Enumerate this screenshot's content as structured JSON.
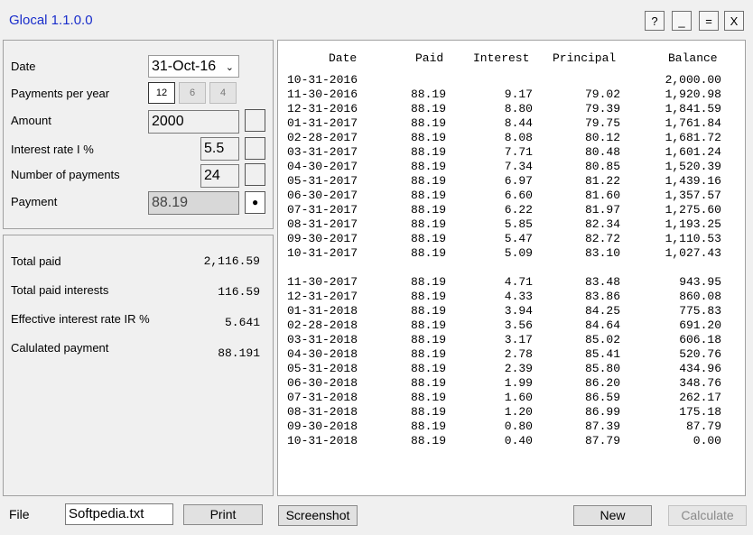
{
  "app": {
    "title": "Glocal 1.1.0.0"
  },
  "window_buttons": {
    "help": "?",
    "minimize": "_",
    "maximize": "=",
    "close": "X"
  },
  "inputs": {
    "date_label": "Date",
    "date_value": "31-Oct-16",
    "ppy_label": "Payments per year",
    "ppy_options": [
      "12",
      "6",
      "4"
    ],
    "amount_label": "Amount",
    "amount_value": "2000",
    "rate_label": "Interest rate I %",
    "rate_value": "5.5",
    "num_label": "Number of payments",
    "num_value": "24",
    "payment_label": "Payment",
    "payment_value": "88.19"
  },
  "summary": {
    "total_paid_label": "Total paid",
    "total_paid": "2,116.59",
    "total_interest_label": "Total paid interests",
    "total_interest": "116.59",
    "eff_rate_label": "Effective interest rate IR %",
    "eff_rate": "5.641",
    "calc_payment_label": "Calulated payment",
    "calc_payment": "88.191"
  },
  "table": {
    "headers": {
      "date": "Date",
      "paid": "Paid",
      "interest": "Interest",
      "principal": "Principal",
      "balance": "Balance"
    },
    "rows": [
      {
        "date": "10-31-2016",
        "paid": "",
        "interest": "",
        "principal": "",
        "balance": "2,000.00"
      },
      {
        "date": "11-30-2016",
        "paid": "88.19",
        "interest": "9.17",
        "principal": "79.02",
        "balance": "1,920.98"
      },
      {
        "date": "12-31-2016",
        "paid": "88.19",
        "interest": "8.80",
        "principal": "79.39",
        "balance": "1,841.59"
      },
      {
        "date": "01-31-2017",
        "paid": "88.19",
        "interest": "8.44",
        "principal": "79.75",
        "balance": "1,761.84"
      },
      {
        "date": "02-28-2017",
        "paid": "88.19",
        "interest": "8.08",
        "principal": "80.12",
        "balance": "1,681.72"
      },
      {
        "date": "03-31-2017",
        "paid": "88.19",
        "interest": "7.71",
        "principal": "80.48",
        "balance": "1,601.24"
      },
      {
        "date": "04-30-2017",
        "paid": "88.19",
        "interest": "7.34",
        "principal": "80.85",
        "balance": "1,520.39"
      },
      {
        "date": "05-31-2017",
        "paid": "88.19",
        "interest": "6.97",
        "principal": "81.22",
        "balance": "1,439.16"
      },
      {
        "date": "06-30-2017",
        "paid": "88.19",
        "interest": "6.60",
        "principal": "81.60",
        "balance": "1,357.57"
      },
      {
        "date": "07-31-2017",
        "paid": "88.19",
        "interest": "6.22",
        "principal": "81.97",
        "balance": "1,275.60"
      },
      {
        "date": "08-31-2017",
        "paid": "88.19",
        "interest": "5.85",
        "principal": "82.34",
        "balance": "1,193.25"
      },
      {
        "date": "09-30-2017",
        "paid": "88.19",
        "interest": "5.47",
        "principal": "82.72",
        "balance": "1,110.53"
      },
      {
        "date": "10-31-2017",
        "paid": "88.19",
        "interest": "5.09",
        "principal": "83.10",
        "balance": "1,027.43"
      },
      {
        "date": "",
        "paid": "",
        "interest": "",
        "principal": "",
        "balance": ""
      },
      {
        "date": "11-30-2017",
        "paid": "88.19",
        "interest": "4.71",
        "principal": "83.48",
        "balance": "943.95"
      },
      {
        "date": "12-31-2017",
        "paid": "88.19",
        "interest": "4.33",
        "principal": "83.86",
        "balance": "860.08"
      },
      {
        "date": "01-31-2018",
        "paid": "88.19",
        "interest": "3.94",
        "principal": "84.25",
        "balance": "775.83"
      },
      {
        "date": "02-28-2018",
        "paid": "88.19",
        "interest": "3.56",
        "principal": "84.64",
        "balance": "691.20"
      },
      {
        "date": "03-31-2018",
        "paid": "88.19",
        "interest": "3.17",
        "principal": "85.02",
        "balance": "606.18"
      },
      {
        "date": "04-30-2018",
        "paid": "88.19",
        "interest": "2.78",
        "principal": "85.41",
        "balance": "520.76"
      },
      {
        "date": "05-31-2018",
        "paid": "88.19",
        "interest": "2.39",
        "principal": "85.80",
        "balance": "434.96"
      },
      {
        "date": "06-30-2018",
        "paid": "88.19",
        "interest": "1.99",
        "principal": "86.20",
        "balance": "348.76"
      },
      {
        "date": "07-31-2018",
        "paid": "88.19",
        "interest": "1.60",
        "principal": "86.59",
        "balance": "262.17"
      },
      {
        "date": "08-31-2018",
        "paid": "88.19",
        "interest": "1.20",
        "principal": "86.99",
        "balance": "175.18"
      },
      {
        "date": "09-30-2018",
        "paid": "88.19",
        "interest": "0.80",
        "principal": "87.39",
        "balance": "87.79"
      },
      {
        "date": "10-31-2018",
        "paid": "88.19",
        "interest": "0.40",
        "principal": "87.79",
        "balance": "0.00"
      }
    ]
  },
  "footer": {
    "file_label": "File",
    "file_value": "Softpedia.txt",
    "print": "Print",
    "screenshot": "Screenshot",
    "new": "New",
    "calculate": "Calculate"
  },
  "colors": {
    "title": "#1a2ecb",
    "background": "#f0f0f0"
  }
}
